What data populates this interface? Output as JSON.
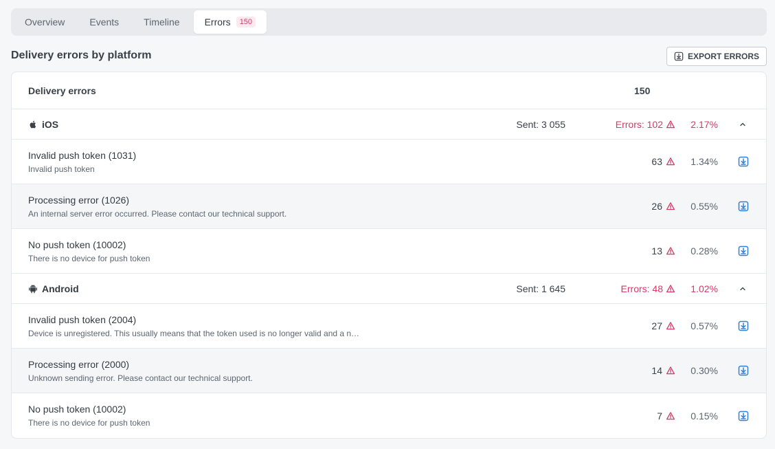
{
  "tabs": [
    {
      "label": "Overview"
    },
    {
      "label": "Events"
    },
    {
      "label": "Timeline"
    },
    {
      "label": "Errors",
      "badge": "150"
    }
  ],
  "section_title": "Delivery errors by platform",
  "export_label": "EXPORT ERRORS",
  "summary": {
    "label": "Delivery errors",
    "total": "150"
  },
  "platforms": [
    {
      "name": "iOS",
      "icon": "apple-icon",
      "sent": "Sent: 3 055",
      "errors": "Errors: 102",
      "percent": "2.17%",
      "rows": [
        {
          "title": "Invalid push token (1031)",
          "desc": "Invalid push token",
          "count": "63",
          "percent": "1.34%"
        },
        {
          "title": "Processing error (1026)",
          "desc": "An internal server error occurred. Please contact our technical support.",
          "count": "26",
          "percent": "0.55%"
        },
        {
          "title": "No push token (10002)",
          "desc": "There is no device for push token",
          "count": "13",
          "percent": "0.28%"
        }
      ]
    },
    {
      "name": "Android",
      "icon": "android-icon",
      "sent": "Sent: 1 645",
      "errors": "Errors: 48",
      "percent": "1.02%",
      "rows": [
        {
          "title": "Invalid push token (2004)",
          "desc": "Device is unregistered. This usually means that the token used is no longer valid and a n…",
          "count": "27",
          "percent": "0.57%"
        },
        {
          "title": "Processing error (2000)",
          "desc": "Unknown sending error. Please contact our technical support.",
          "count": "14",
          "percent": "0.30%"
        },
        {
          "title": "No push token (10002)",
          "desc": "There is no device for push token",
          "count": "7",
          "percent": "0.15%"
        }
      ]
    }
  ],
  "colors": {
    "error": "#d43a66",
    "download": "#2f7fd6",
    "accent_bg": "#fde9ee"
  }
}
